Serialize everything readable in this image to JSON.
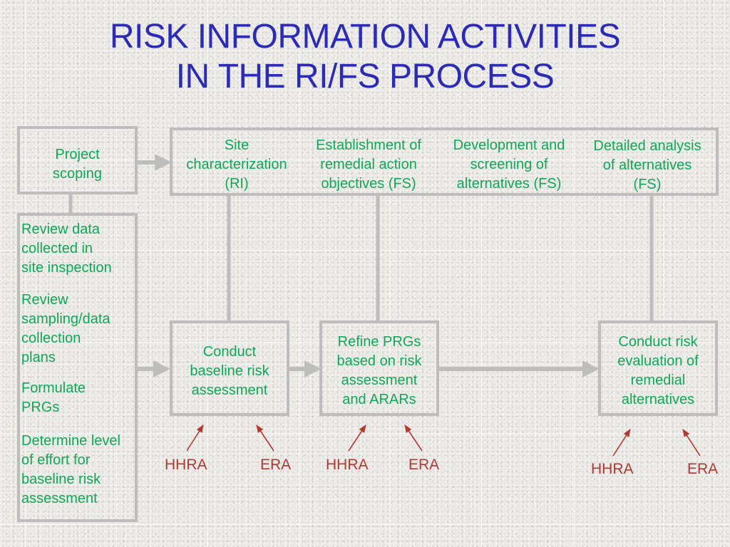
{
  "title": {
    "line1": "RISK INFORMATION ACTIVITIES",
    "line2": "IN THE RI/FS PROCESS"
  },
  "colors": {
    "title": "#2b2bb3",
    "activity_text": "#10a858",
    "assessment_text": "#b03a32",
    "box_border": "#bdbdbb"
  },
  "project_scoping": {
    "label": "Project scoping",
    "lines": [
      "Project",
      "scoping"
    ]
  },
  "phases": [
    {
      "lines": [
        "Site",
        "characterization",
        "(RI)"
      ]
    },
    {
      "lines": [
        "Establishment of",
        "remedial action",
        "objectives (FS)"
      ]
    },
    {
      "lines": [
        "Development and",
        "screening of",
        "alternatives (FS)"
      ]
    },
    {
      "lines": [
        "Detailed analysis",
        "of alternatives",
        "(FS)"
      ]
    }
  ],
  "scoping_tasks": [
    {
      "lines": [
        "Review data",
        "collected in",
        "site inspection"
      ]
    },
    {
      "lines": [
        "Review",
        "sampling/data",
        "collection",
        "plans"
      ]
    },
    {
      "lines": [
        "Formulate",
        "PRGs"
      ]
    },
    {
      "lines": [
        "Determine level",
        "of effort for",
        "baseline risk",
        "assessment"
      ]
    }
  ],
  "risk_activities": [
    {
      "lines": [
        "Conduct",
        "baseline risk",
        "assessment"
      ],
      "inputs": [
        "HHRA",
        "ERA"
      ]
    },
    {
      "lines": [
        "Refine PRGs",
        "based on risk",
        "assessment",
        "and ARARs"
      ],
      "inputs": [
        "HHRA",
        "ERA"
      ]
    },
    {
      "lines": [
        "Conduct risk",
        "evaluation of",
        "remedial",
        "alternatives"
      ],
      "inputs": [
        "HHRA",
        "ERA"
      ]
    }
  ]
}
